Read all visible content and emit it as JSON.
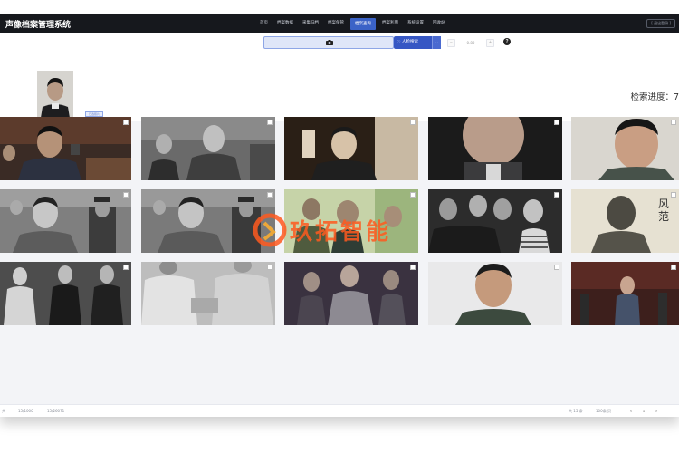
{
  "app": {
    "title": "声像档案管理系统",
    "logout": "[ 退出登录 ]"
  },
  "nav": {
    "items": [
      {
        "label": "首页",
        "active": false
      },
      {
        "label": "档案数据",
        "active": false
      },
      {
        "label": "采集归档",
        "active": false
      },
      {
        "label": "档案保管",
        "active": false
      },
      {
        "label": "档案查询",
        "active": true
      },
      {
        "label": "档案利用",
        "active": false
      },
      {
        "label": "系统设置",
        "active": false
      },
      {
        "label": "回收站",
        "active": false
      }
    ]
  },
  "search": {
    "camera_icon": "camera-icon",
    "button_label": "人脸搜索",
    "button_icon": "heart-icon",
    "dropdown_icon": "chevron-down-icon",
    "threshold_value": "0.80",
    "help": "?"
  },
  "query": {
    "tag": "已选照片",
    "progress_label": "检索进度：7"
  },
  "results": {
    "watermark": "玖拓智能",
    "tiles": [
      {
        "desc": "photo-1"
      },
      {
        "desc": "photo-2"
      },
      {
        "desc": "photo-3"
      },
      {
        "desc": "photo-4"
      },
      {
        "desc": "photo-5"
      },
      {
        "desc": "photo-6"
      },
      {
        "desc": "photo-7"
      },
      {
        "desc": "photo-8"
      },
      {
        "desc": "photo-9"
      },
      {
        "desc": "photo-10"
      },
      {
        "desc": "photo-11"
      },
      {
        "desc": "photo-12"
      },
      {
        "desc": "photo-13"
      },
      {
        "desc": "photo-14"
      },
      {
        "desc": "photo-15"
      }
    ]
  },
  "footer": {
    "left_items": [
      "共",
      "15/1000",
      "15/26071"
    ],
    "right_page_info": "共 15 条",
    "right_page_size": "100条/页",
    "pager": [
      "<",
      "1",
      ">"
    ]
  },
  "colors": {
    "topbar": "#16181d",
    "accent": "#3657c4",
    "watermark": "#ff5a1f"
  }
}
